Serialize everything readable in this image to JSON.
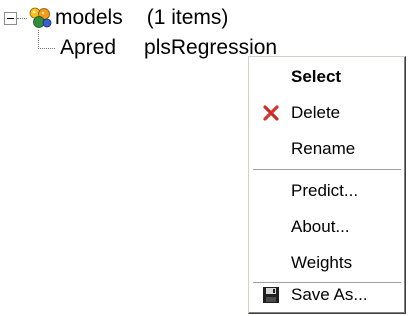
{
  "tree": {
    "root": {
      "icon": "models-folder-icon",
      "label": "models",
      "count": "(1 items)",
      "expanded": true
    },
    "children": [
      {
        "name": "Apred",
        "type": "plsRegression"
      }
    ]
  },
  "context_menu": {
    "items": [
      {
        "label": "Select",
        "icon": null,
        "default": true
      },
      {
        "label": "Delete",
        "icon": "delete-x-icon",
        "icon_color": "#d8342c"
      },
      {
        "label": "Rename",
        "icon": null
      },
      {
        "label": "Predict...",
        "icon": null
      },
      {
        "label": "About...",
        "icon": null
      },
      {
        "label": "Weights",
        "icon": null
      },
      {
        "label": "Save As...",
        "icon": "floppy-disk-icon"
      }
    ]
  }
}
